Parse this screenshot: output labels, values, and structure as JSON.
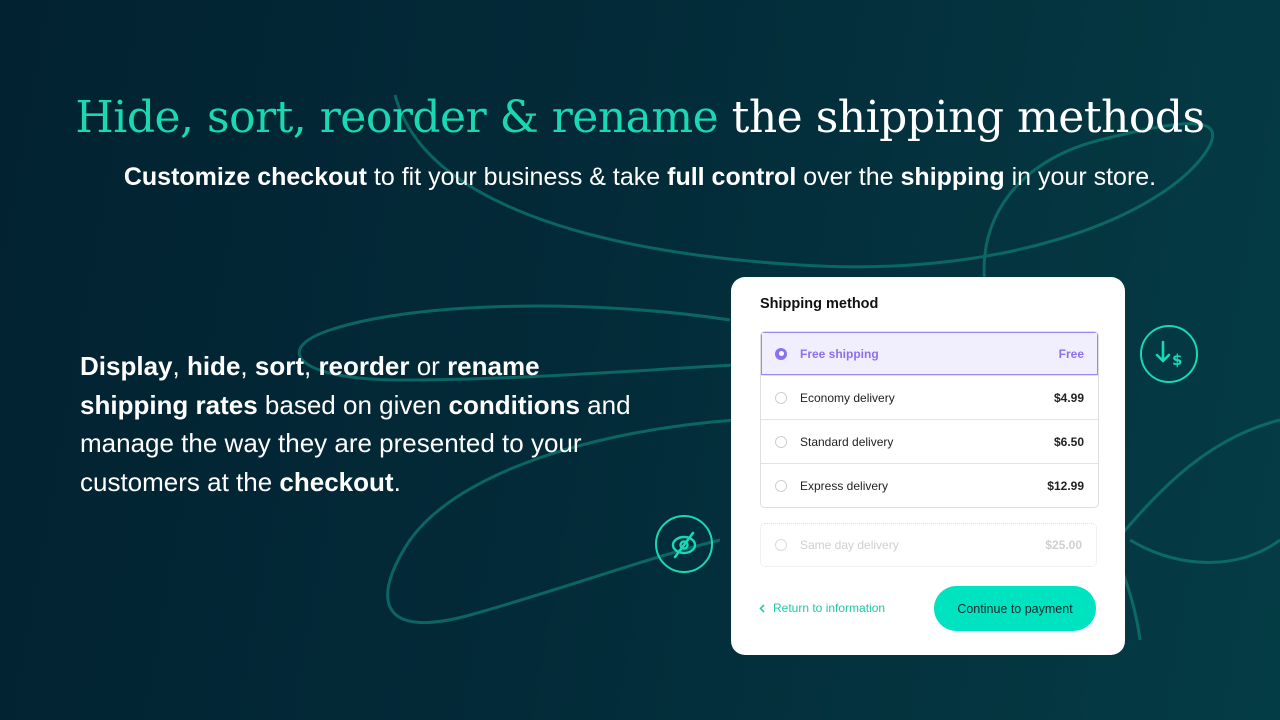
{
  "headline": {
    "accent": "Hide, sort, reorder & rename",
    "plain": " the shipping methods"
  },
  "subheadline": {
    "b1": "Customize checkout",
    "t1": " to fit your business & take ",
    "b2": "full control",
    "t2": " over the ",
    "b3": "shipping",
    "t3": " in your store."
  },
  "body": {
    "b1": "Display",
    "t1": ", ",
    "b2": "hide",
    "t2": ", ",
    "b3": "sort",
    "t3": ", ",
    "b4": "reorder",
    "t4": " or ",
    "b5": "rename shipping rates",
    "t5": " based on given ",
    "b6": "conditions",
    "t6": " and manage the way they are presented to your customers at the ",
    "b7": "checkout",
    "t7": "."
  },
  "card": {
    "title": "Shipping method",
    "options": [
      {
        "label": "Free shipping",
        "price": "Free",
        "selected": true
      },
      {
        "label": "Economy delivery",
        "price": "$4.99",
        "selected": false
      },
      {
        "label": "Standard delivery",
        "price": "$6.50",
        "selected": false
      },
      {
        "label": "Express delivery",
        "price": "$12.99",
        "selected": false
      }
    ],
    "hidden_option": {
      "label": "Same day delivery",
      "price": "$25.00"
    },
    "back_link": "Return to information",
    "back_icon": "chevron-left-icon",
    "continue_button": "Continue to payment"
  },
  "badges": {
    "price_drop": "arrow-down-dollar-icon",
    "hide": "eye-slash-icon"
  },
  "colors": {
    "accent": "#19d9b4",
    "selected": "#8b71f0",
    "button": "#00e3c1",
    "background": "#022231"
  }
}
